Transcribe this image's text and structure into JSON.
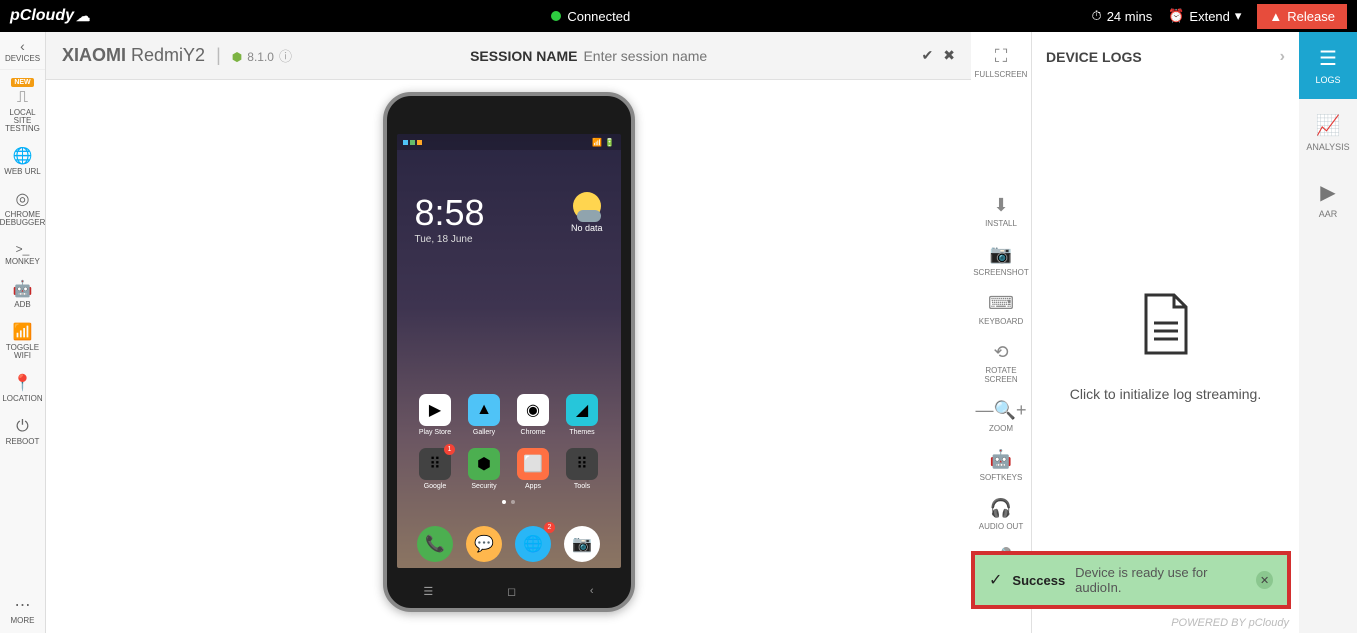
{
  "topbar": {
    "logo": "pCloudy",
    "status": "Connected",
    "timer": "24 mins",
    "extend": "Extend",
    "release": "Release"
  },
  "leftbar": {
    "header": "DEVICES",
    "items": [
      {
        "label": "LOCAL SITE TESTING",
        "icon": "usb",
        "badge": "NEW"
      },
      {
        "label": "WEB URL",
        "icon": "globe"
      },
      {
        "label": "CHROME DEBUGGER",
        "icon": "chrome"
      },
      {
        "label": "MONKEY",
        "icon": "terminal"
      },
      {
        "label": "ADB",
        "icon": "android"
      },
      {
        "label": "TOGGLE WIFI",
        "icon": "wifi"
      },
      {
        "label": "LOCATION",
        "icon": "pin"
      },
      {
        "label": "REBOOT",
        "icon": "power"
      }
    ],
    "more": "MORE"
  },
  "session": {
    "brand": "XIAOMI",
    "model": "RedmiY2",
    "os_version": "8.1.0",
    "name_label": "SESSION NAME",
    "name_placeholder": "Enter session name"
  },
  "tools": [
    {
      "label": "FULLSCREEN",
      "icon": "fullscreen"
    },
    {
      "label": "INSTALL",
      "icon": "download"
    },
    {
      "label": "SCREENSHOT",
      "icon": "camera"
    },
    {
      "label": "KEYBOARD",
      "icon": "keyboard"
    },
    {
      "label": "ROTATE SCREEN",
      "icon": "rotate"
    },
    {
      "label": "ZOOM",
      "icon": "zoom"
    },
    {
      "label": "SOFTKEYS",
      "icon": "android"
    },
    {
      "label": "AUDIO OUT",
      "icon": "headphones"
    },
    {
      "label": "AUDIO IN",
      "icon": "mic",
      "active": true
    }
  ],
  "rightpanel": {
    "title": "DEVICE LOGS",
    "body": "Click to initialize log streaming.",
    "powered": "POWERED BY pCloudy"
  },
  "righttabs": [
    {
      "label": "LOGS",
      "icon": "list",
      "active": true
    },
    {
      "label": "ANALYSIS",
      "icon": "chart"
    },
    {
      "label": "AAR",
      "icon": "play"
    }
  ],
  "phone": {
    "time": "8:58",
    "date": "Tue, 18 June",
    "weather": "No data",
    "apps_row1": [
      {
        "label": "Play Store",
        "bg": "#fff",
        "glyph": "▶"
      },
      {
        "label": "Gallery",
        "bg": "#4fc3f7",
        "glyph": "▲"
      },
      {
        "label": "Chrome",
        "bg": "#fff",
        "glyph": "◉"
      },
      {
        "label": "Themes",
        "bg": "#26c6da",
        "glyph": "◢"
      }
    ],
    "apps_row2": [
      {
        "label": "Google",
        "bg": "#424242",
        "glyph": "⠿",
        "badge": "1"
      },
      {
        "label": "Security",
        "bg": "#4caf50",
        "glyph": "⬢"
      },
      {
        "label": "Apps",
        "bg": "#ff7043",
        "glyph": "⬜"
      },
      {
        "label": "Tools",
        "bg": "#424242",
        "glyph": "⠿"
      }
    ],
    "dock": [
      {
        "bg": "#4caf50",
        "glyph": "📞"
      },
      {
        "bg": "#ffb74d",
        "glyph": "💬"
      },
      {
        "bg": "#29b6f6",
        "glyph": "🌐",
        "badge": "2"
      },
      {
        "bg": "#fff",
        "glyph": "📷"
      }
    ]
  },
  "toast": {
    "title": "Success",
    "message": "Device is ready use for audioIn."
  }
}
